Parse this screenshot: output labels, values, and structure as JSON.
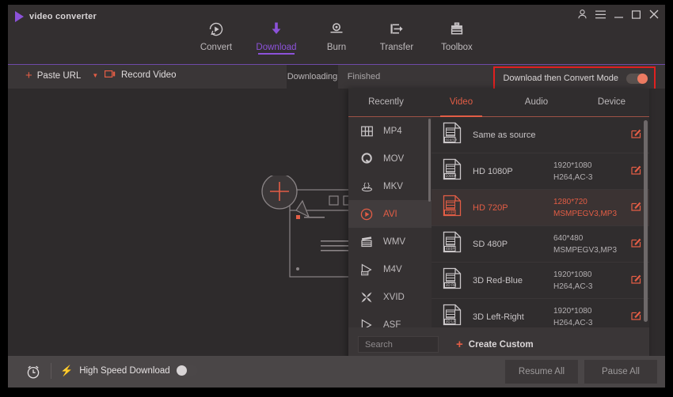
{
  "window": {
    "app_title": "video converter",
    "logo_color": "#8c52d9",
    "controls": [
      {
        "name": "account-icon",
        "glyph": "person"
      },
      {
        "name": "menu-icon",
        "glyph": "hamburger"
      },
      {
        "name": "minimize-button",
        "glyph": "minimize"
      },
      {
        "name": "maximize-button",
        "glyph": "maximize"
      },
      {
        "name": "close-button",
        "glyph": "close"
      }
    ]
  },
  "nav": {
    "active": "Download",
    "accent": "#8c52d9",
    "items": [
      {
        "label": "Convert",
        "icon": "convert-icon"
      },
      {
        "label": "Download",
        "icon": "download-icon"
      },
      {
        "label": "Burn",
        "icon": "burn-icon"
      },
      {
        "label": "Transfer",
        "icon": "transfer-icon"
      },
      {
        "label": "Toolbox",
        "icon": "toolbox-icon"
      }
    ]
  },
  "toolbar": {
    "paste_url_label": "Paste URL",
    "record_video_label": "Record Video",
    "tabs": [
      {
        "label": "Downloading",
        "active": true
      },
      {
        "label": "Finished",
        "active": false
      }
    ],
    "convert_mode_label": "Download then Convert Mode",
    "convert_mode_on": true,
    "highlight_color": "#e02020"
  },
  "format_popup": {
    "accent": "#e35d45",
    "tabs": [
      {
        "label": "Recently",
        "active": false
      },
      {
        "label": "Video",
        "active": true
      },
      {
        "label": "Audio",
        "active": false
      },
      {
        "label": "Device",
        "active": false
      }
    ],
    "formats": [
      {
        "label": "MP4",
        "icon": "mp4-icon",
        "active": false
      },
      {
        "label": "MOV",
        "icon": "mov-icon",
        "active": false
      },
      {
        "label": "MKV",
        "icon": "mkv-icon",
        "active": false
      },
      {
        "label": "AVI",
        "icon": "avi-icon",
        "active": true
      },
      {
        "label": "WMV",
        "icon": "wmv-icon",
        "active": false
      },
      {
        "label": "M4V",
        "icon": "m4v-icon",
        "active": false
      },
      {
        "label": "XVID",
        "icon": "xvid-icon",
        "active": false
      },
      {
        "label": "ASF",
        "icon": "asf-icon",
        "active": false
      }
    ],
    "presets": [
      {
        "name": "Same as source",
        "badge": "source",
        "resolution": "",
        "codecs": "",
        "active": false
      },
      {
        "name": "HD 1080P",
        "badge": "1080P",
        "resolution": "1920*1080",
        "codecs": "H264,AC-3",
        "active": false
      },
      {
        "name": "HD 720P",
        "badge": "720P",
        "resolution": "1280*720",
        "codecs": "MSMPEGV3,MP3",
        "active": true
      },
      {
        "name": "SD 480P",
        "badge": "480P",
        "resolution": "640*480",
        "codecs": "MSMPEGV3,MP3",
        "active": false
      },
      {
        "name": "3D Red-Blue",
        "badge": "3D RB",
        "resolution": "1920*1080",
        "codecs": "H264,AC-3",
        "active": false
      },
      {
        "name": "3D Left-Right",
        "badge": "3D LR",
        "resolution": "1920*1080",
        "codecs": "H264,AC-3",
        "active": false
      }
    ],
    "search_placeholder": "Search",
    "search_value": "",
    "create_custom_label": "Create Custom"
  },
  "bottom": {
    "timer_icon": "alarm-clock-icon",
    "high_speed_label": "High Speed Download",
    "high_speed_on": false,
    "resume_all_label": "Resume All",
    "pause_all_label": "Pause All"
  }
}
